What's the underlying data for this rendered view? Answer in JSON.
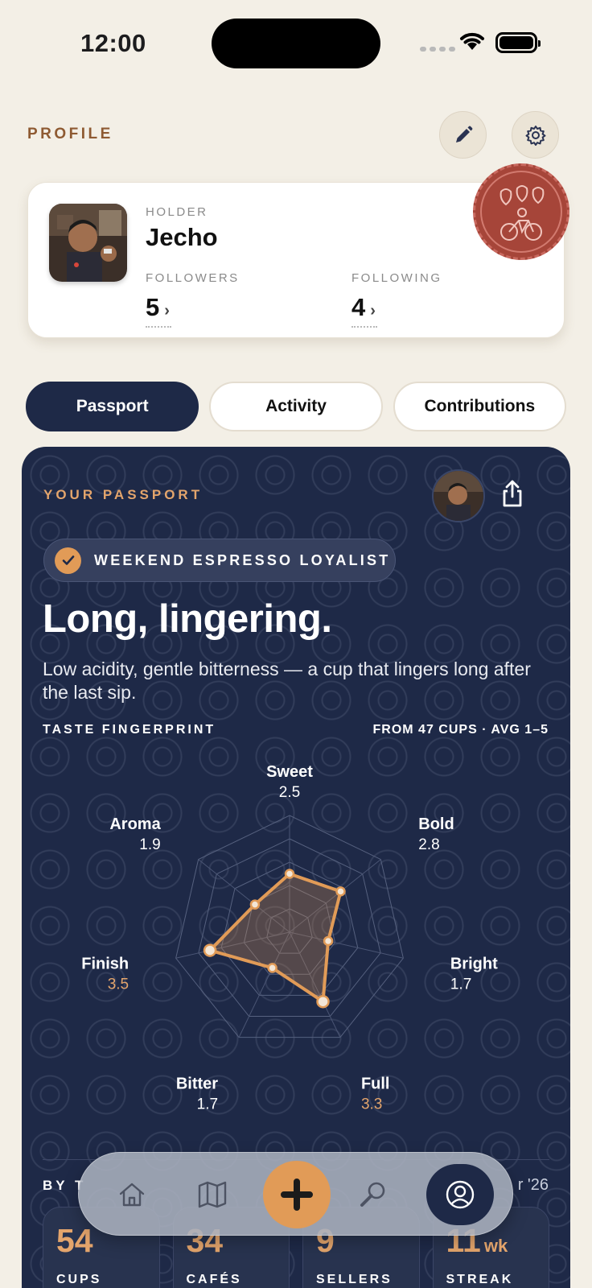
{
  "status_bar": {
    "time": "12:00"
  },
  "header": {
    "title": "PROFILE"
  },
  "profile_card": {
    "holder_label": "HOLDER",
    "holder_name": "Jecho",
    "followers_label": "FOLLOWERS",
    "followers_count": "5",
    "following_label": "FOLLOWING",
    "following_count": "4"
  },
  "tabs": [
    {
      "label": "Passport",
      "active": true
    },
    {
      "label": "Activity",
      "active": false
    },
    {
      "label": "Contributions",
      "active": false
    }
  ],
  "passport": {
    "label": "YOUR PASSPORT",
    "badge": "WEEKEND ESPRESSO LOYALIST",
    "headline": "Long, lingering.",
    "description": "Low acidity, gentle bitterness — a cup that lingers long after the last sip.",
    "fingerprint_label": "TASTE FINGERPRINT",
    "fingerprint_meta": "FROM 47 CUPS · AVG 1–5",
    "by_label": "BY T",
    "by_right": "r '26",
    "stats": [
      {
        "value": "54",
        "unit": "",
        "label": "CUPS"
      },
      {
        "value": "34",
        "unit": "",
        "label": "CAFÉS"
      },
      {
        "value": "9",
        "unit": "",
        "label": "SELLERS"
      },
      {
        "value": "11",
        "unit": "wk",
        "label": "STREAK"
      }
    ]
  },
  "chart_data": {
    "type": "radar",
    "scale": [
      0,
      5
    ],
    "categories": [
      "Sweet",
      "Bold",
      "Bright",
      "Full",
      "Bitter",
      "Finish",
      "Aroma"
    ],
    "values": [
      2.5,
      2.8,
      1.7,
      3.3,
      1.7,
      3.5,
      1.9
    ],
    "highlighted": [
      "Full",
      "Finish"
    ]
  },
  "colors": {
    "accent": "#e19b57",
    "navy": "#1e2947",
    "background": "#f3efe6",
    "profile_label": "#8e5a32"
  },
  "nav": {
    "items": [
      "home-icon",
      "map-icon",
      "add-icon",
      "search-icon",
      "profile-icon"
    ]
  }
}
